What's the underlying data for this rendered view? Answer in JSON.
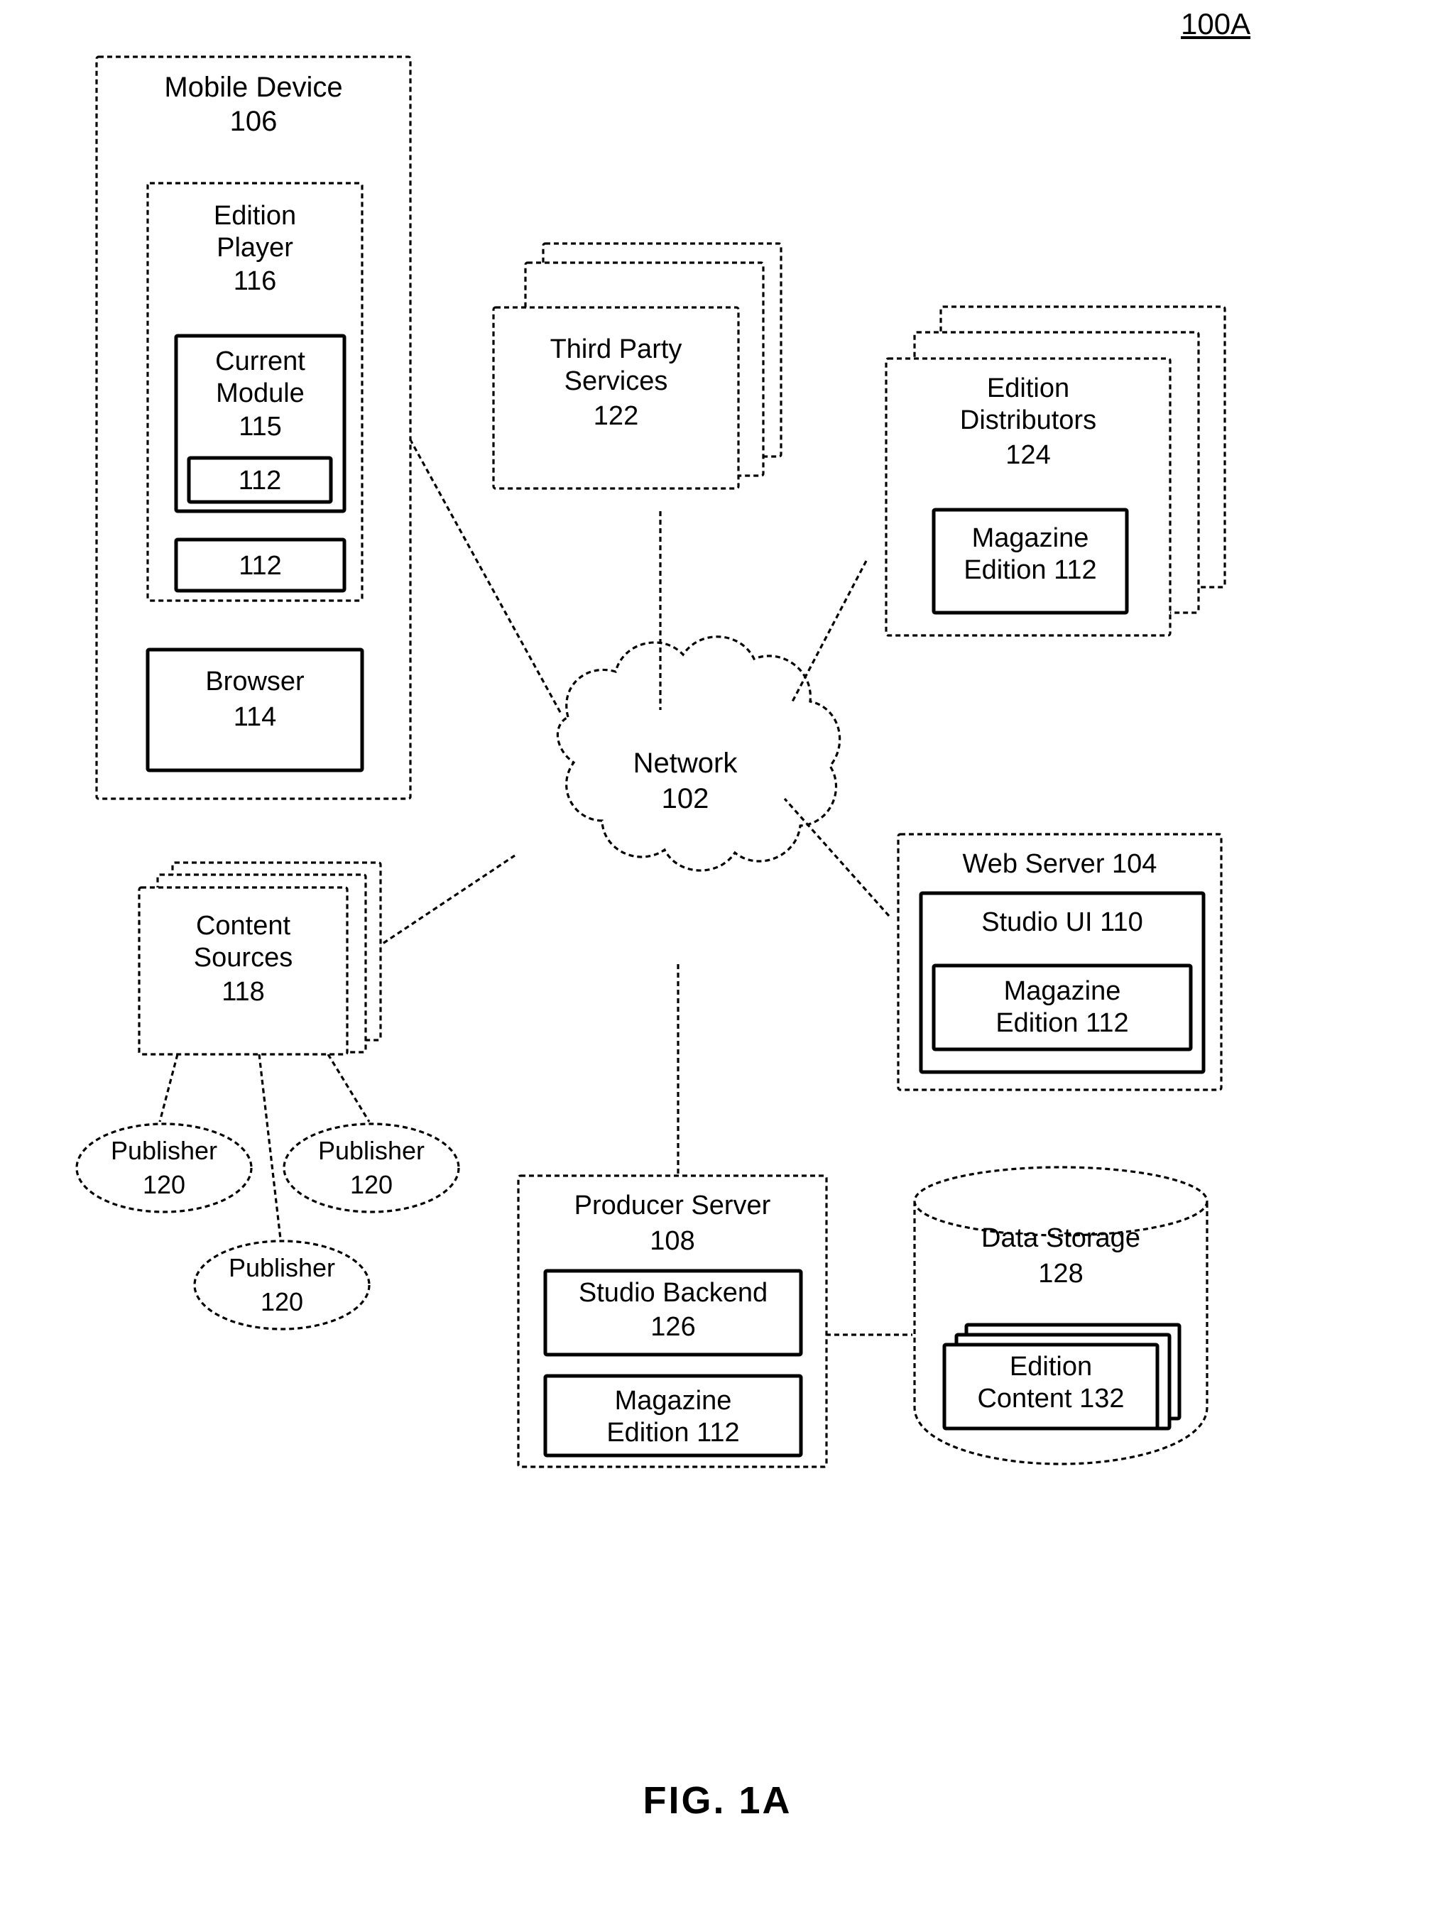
{
  "figure": {
    "reference_number": "100A",
    "caption": "FIG. 1A"
  },
  "nodes": {
    "mobile_device": {
      "label": "Mobile Device",
      "number": "106"
    },
    "edition_player": {
      "label": "Edition\nPlayer",
      "number": "116"
    },
    "current_module": {
      "label": "Current\nModule",
      "number": "115"
    },
    "module_edition_1": {
      "label": "112"
    },
    "module_edition_2": {
      "label": "112"
    },
    "browser": {
      "label": "Browser",
      "number": "114"
    },
    "third_party_services": {
      "label": "Third Party\nServices",
      "number": "122"
    },
    "edition_distributors": {
      "label": "Edition\nDistributors",
      "number": "124"
    },
    "distributor_magazine_edition": {
      "label": "Magazine\nEdition 112"
    },
    "network": {
      "label": "Network",
      "number": "102"
    },
    "web_server": {
      "label": "Web Server 104"
    },
    "studio_ui": {
      "label": "Studio UI 110"
    },
    "studio_magazine_edition": {
      "label": "Magazine\nEdition 112"
    },
    "content_sources": {
      "label": "Content\nSources",
      "number": "118"
    },
    "publisher_1": {
      "label": "Publisher",
      "number": "120"
    },
    "publisher_2": {
      "label": "Publisher",
      "number": "120"
    },
    "publisher_3": {
      "label": "Publisher",
      "number": "120"
    },
    "producer_server": {
      "label": "Producer Server",
      "number": "108"
    },
    "studio_backend": {
      "label": "Studio Backend",
      "number": "126"
    },
    "producer_magazine_edition": {
      "label": "Magazine\nEdition 112"
    },
    "data_storage": {
      "label": "Data Storage",
      "number": "128"
    },
    "edition_content": {
      "label": "Edition\nContent 132"
    }
  },
  "colors": {
    "stroke": "#000000",
    "background": "#ffffff"
  }
}
